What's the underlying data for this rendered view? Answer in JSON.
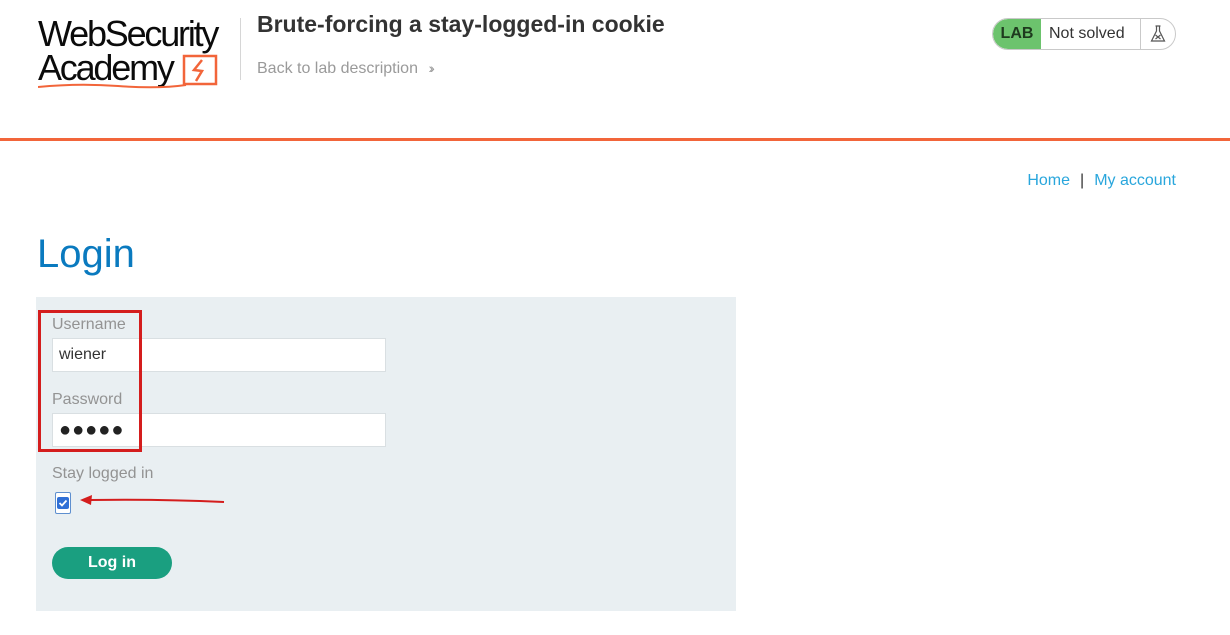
{
  "header": {
    "logo_line1": "WebSecurity",
    "logo_line2": "Academy",
    "lab_title": "Brute-forcing a stay-logged-in cookie",
    "back_link": "Back to lab description",
    "status": {
      "lab_badge": "LAB",
      "status_text": "Not solved",
      "lab_color": "#6cc36d"
    }
  },
  "nav": {
    "home": "Home",
    "separator": "|",
    "account": "My account"
  },
  "login": {
    "title": "Login",
    "username_label": "Username",
    "username_value": "wiener",
    "password_label": "Password",
    "password_value": "●●●●●",
    "stay_logged_in_label": "Stay logged in",
    "stay_logged_in_checked": true,
    "submit_label": "Log in"
  },
  "colors": {
    "accent_orange": "#f2653a",
    "title_blue": "#0a7abf",
    "link_blue": "#29a6dc",
    "button_green": "#1a9f80",
    "annotation_red": "#d41d1d"
  }
}
